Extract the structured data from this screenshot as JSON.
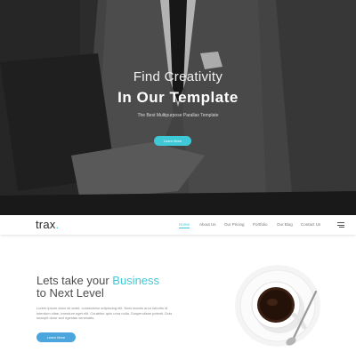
{
  "hero": {
    "title_line1": "Find Creativity",
    "title_line2": "In Our Template",
    "subtitle": "The Best Multipurpose Parallax Template",
    "button_label": "Learn More"
  },
  "navbar": {
    "logo_text": "trax",
    "logo_dot": ".",
    "items": [
      {
        "label": "Home",
        "active": true
      },
      {
        "label": "About Us",
        "active": false
      },
      {
        "label": "Our Pricing",
        "active": false
      },
      {
        "label": "Portfolio",
        "active": false
      },
      {
        "label": "Our Blog",
        "active": false
      },
      {
        "label": "Contact Us",
        "active": false
      }
    ],
    "menu_icon": "hamburger-menu-icon"
  },
  "section": {
    "headline_part1": "Lets take your ",
    "headline_accent": "Business",
    "headline_line2": "to Next Level",
    "body": "Lorem ipsum dolor sit amet, consectetur adipiscing elit. Nam mauris arcu lobortis id interdum vitae, interdum eget elit. Curabitur quis urna nulla. Suspendisse potenti. Duis suscipit dolor sed egestas venenatis.",
    "button_label": "Learn More",
    "image": "coffee-cup-image"
  },
  "colors": {
    "accent": "#3fc9d6",
    "button_blue": "#4aa6dc",
    "hero_overlay": "#3a3a3a"
  }
}
